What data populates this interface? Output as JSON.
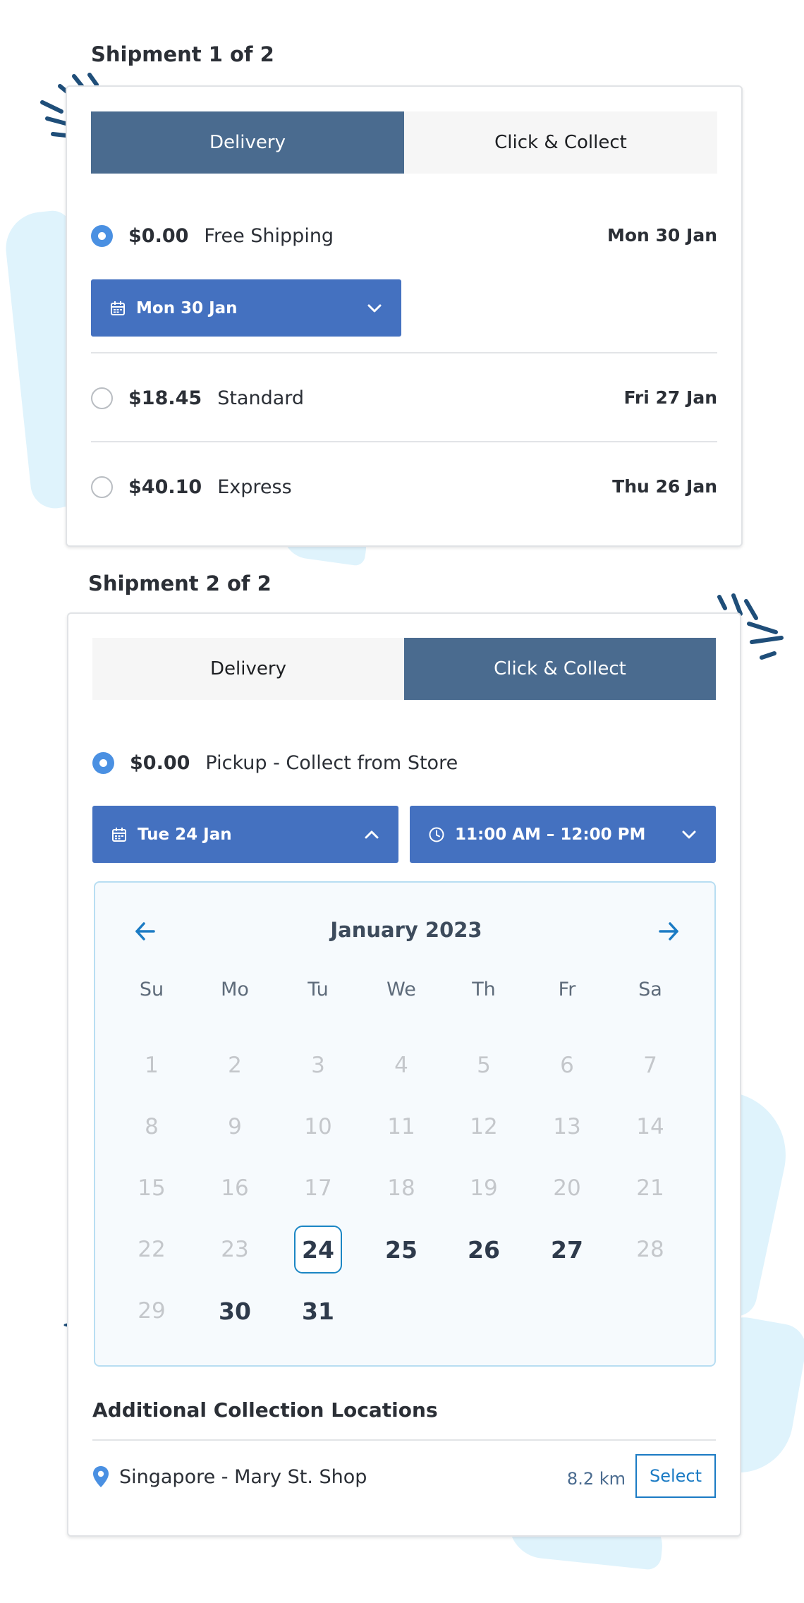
{
  "shipment1": {
    "title": "Shipment 1 of 2",
    "tabs": [
      {
        "label": "Delivery",
        "active": true
      },
      {
        "label": "Click & Collect",
        "active": false
      }
    ],
    "options": [
      {
        "price": "$0.00",
        "method": "Free Shipping",
        "date": "Mon 30 Jan",
        "selected": true
      },
      {
        "price": "$18.45",
        "method": "Standard",
        "date": "Fri 27 Jan",
        "selected": false
      },
      {
        "price": "$40.10",
        "method": "Express",
        "date": "Thu 26 Jan",
        "selected": false
      }
    ],
    "date_dropdown": {
      "label": "Mon 30 Jan",
      "icon": "calendar-icon",
      "state": "collapsed"
    }
  },
  "shipment2": {
    "title": "Shipment 2 of 2",
    "tabs": [
      {
        "label": "Delivery",
        "active": false
      },
      {
        "label": "Click & Collect",
        "active": true
      }
    ],
    "option": {
      "price": "$0.00",
      "method": "Pickup - Collect from Store",
      "selected": true
    },
    "date_dropdown": {
      "label": "Tue 24 Jan",
      "icon": "calendar-icon",
      "state": "expanded"
    },
    "time_dropdown": {
      "label": "11:00 AM – 12:00 PM",
      "icon": "clock-icon",
      "state": "collapsed"
    },
    "calendar": {
      "month_label": "January 2023",
      "weekdays": [
        "Su",
        "Mo",
        "Tu",
        "We",
        "Th",
        "Fr",
        "Sa"
      ],
      "weeks": [
        [
          "1",
          "2",
          "3",
          "4",
          "5",
          "6",
          "7"
        ],
        [
          "8",
          "9",
          "10",
          "11",
          "12",
          "13",
          "14"
        ],
        [
          "15",
          "16",
          "17",
          "18",
          "19",
          "20",
          "21"
        ],
        [
          "22",
          "23",
          "24",
          "25",
          "26",
          "27",
          "28"
        ],
        [
          "29",
          "30",
          "31"
        ]
      ],
      "available_days": [
        "24",
        "25",
        "26",
        "27",
        "30",
        "31"
      ],
      "selected_day": "24"
    },
    "additional_locations": {
      "title": "Additional Collection Locations",
      "items": [
        {
          "name": "Singapore - Mary St. Shop",
          "distance": "8.2 km",
          "button": "Select",
          "icon": "map-pin-icon"
        }
      ]
    }
  },
  "colors": {
    "active_tab": "#4a6b8f",
    "dropdown": "#4471c0",
    "radio_selected": "#4a90e2",
    "link": "#1b7bc4",
    "calendar_border": "#b8def2",
    "splash": "#dff3fc",
    "decoration": "#1f4e79"
  }
}
